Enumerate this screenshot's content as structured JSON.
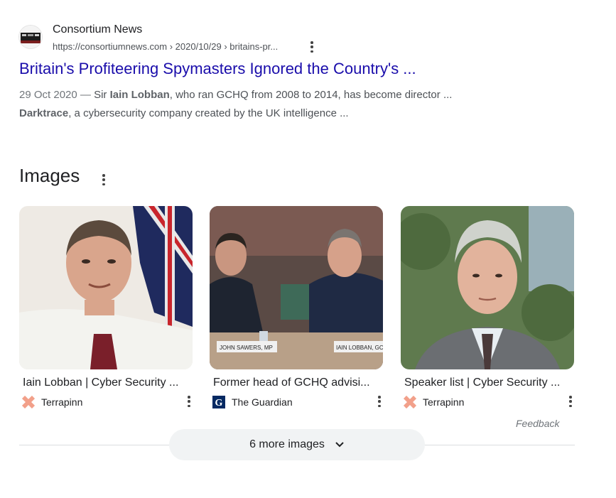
{
  "result": {
    "site_name": "Consortium News",
    "url": "https://consortiumnews.com › 2020/10/29 › britains-pr...",
    "title": "Britain's Profiteering Spymasters Ignored the Country's ...",
    "snippet": {
      "date": "29 Oct 2020 —",
      "line1_pre": "Sir ",
      "line1_bold": "Iain Lobban",
      "line1_post": ", who ran GCHQ from 2008 to 2014, has become director ...",
      "line2_bold": "Darktrace",
      "line2_post": ", a cybersecurity company created by the UK intelligence ..."
    }
  },
  "images_section": {
    "heading": "Images",
    "cards": [
      {
        "caption": "Iain Lobban | Cyber Security ...",
        "source": "Terrapinn",
        "source_icon": "terrapinn-logo-icon"
      },
      {
        "caption": "Former head of GCHQ advisi...",
        "source": "The Guardian",
        "source_icon": "guardian-logo-icon"
      },
      {
        "caption": "Speaker list | Cyber Security ...",
        "source": "Terrapinn",
        "source_icon": "terrapinn-logo-icon"
      }
    ],
    "photo_text": {
      "nameplate_left": "JOHN SAWERS, MP",
      "nameplate_right": "IAIN LOBBAN, GC"
    },
    "feedback": "Feedback",
    "more_button": "6 more images"
  },
  "colors": {
    "link": "#1a0dab",
    "snippet": "#4d5156",
    "terrapinn": "#f2a08a",
    "guardian": "#052962"
  }
}
